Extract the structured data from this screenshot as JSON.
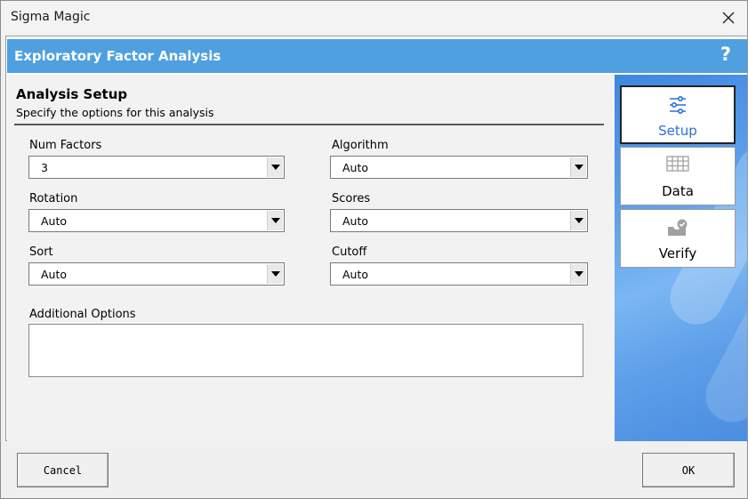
{
  "window": {
    "title": "Sigma Magic"
  },
  "header": {
    "title": "Exploratory Factor Analysis",
    "help": "?"
  },
  "setup": {
    "title": "Analysis Setup",
    "subtitle": "Specify the options for this analysis",
    "num_factors": {
      "label": "Num Factors",
      "value": "3"
    },
    "algorithm": {
      "label": "Algorithm",
      "value": "Auto"
    },
    "rotation": {
      "label": "Rotation",
      "value": "Auto"
    },
    "scores": {
      "label": "Scores",
      "value": "Auto"
    },
    "sort": {
      "label": "Sort",
      "value": "Auto"
    },
    "cutoff": {
      "label": "Cutoff",
      "value": "Auto"
    },
    "additional": {
      "label": "Additional Options",
      "value": ""
    }
  },
  "nav": {
    "setup": "Setup",
    "data": "Data",
    "verify": "Verify"
  },
  "footer": {
    "cancel": "Cancel",
    "ok": "OK"
  },
  "colors": {
    "header": "#4ea0e0",
    "active_nav_text": "#2b6fd0",
    "icon_gray": "#a0a0a0"
  },
  "icons": {
    "close": "close-icon",
    "setup": "sliders-icon",
    "data": "table-grid-icon",
    "verify": "inbox-check-icon"
  }
}
